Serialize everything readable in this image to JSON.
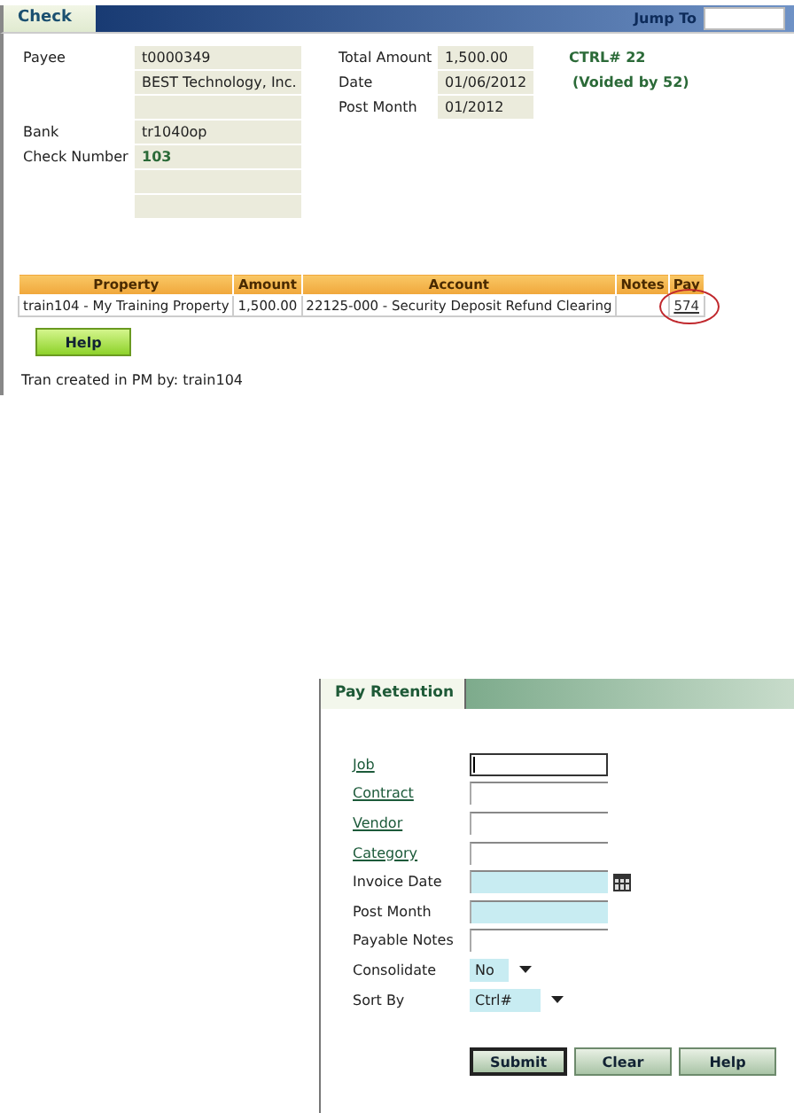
{
  "check": {
    "title": "Check",
    "jump_to": {
      "label": "Jump To"
    },
    "left_rows": [
      {
        "kind": "text",
        "label": "Payee",
        "value": "t0000349"
      },
      {
        "kind": "text",
        "value": "BEST Technology, Inc."
      },
      {
        "kind": "blank"
      },
      {
        "kind": "text",
        "label": "Bank",
        "value": "tr1040op"
      },
      {
        "kind": "strong",
        "label": "Check Number",
        "value": "103"
      },
      {
        "kind": "blank"
      },
      {
        "kind": "blank"
      }
    ],
    "right_rows": [
      {
        "label": "Total Amount",
        "value": "1,500.00"
      },
      {
        "label": "Date",
        "value": "01/06/2012"
      },
      {
        "label": "Post Month",
        "value": "01/2012"
      }
    ],
    "status": [
      "CTRL# 22",
      "(Voided by 52)"
    ],
    "table": {
      "columns": [
        "Property",
        "Amount",
        "Account",
        "Notes",
        "Pay"
      ],
      "rows": [
        {
          "property": "train104 - My Training Property",
          "amount": "1,500.00",
          "account": "22125-000 - Security Deposit Refund Clearing",
          "pay": "574",
          "pay_circled": true
        }
      ]
    },
    "help_button": "Help",
    "footer": "Tran created in PM by: train104"
  },
  "pay_retention": {
    "title": "Pay Retention",
    "fields": [
      {
        "kind": "link",
        "label": "Job",
        "highlighted": false,
        "focused": true
      },
      {
        "kind": "link",
        "label": "Contract",
        "highlighted": false,
        "focused": false
      },
      {
        "kind": "link",
        "label": "Vendor",
        "highlighted": false,
        "focused": false
      },
      {
        "kind": "link",
        "label": "Category",
        "highlighted": false,
        "focused": false
      },
      {
        "kind": "date",
        "label": "Invoice Date",
        "highlighted": true,
        "focused": false
      },
      {
        "kind": "input",
        "label": "Post Month",
        "highlighted": true,
        "focused": false
      },
      {
        "kind": "input",
        "label": "Payable Notes",
        "highlighted": false,
        "focused": false
      },
      {
        "kind": "select",
        "label": "Consolidate",
        "value": "No"
      },
      {
        "kind": "select",
        "label": "Sort By",
        "value": "Ctrl#"
      }
    ],
    "buttons": [
      {
        "label": "Submit",
        "default": true
      },
      {
        "label": "Clear",
        "default": false
      },
      {
        "label": "Help",
        "default": false
      }
    ]
  }
}
